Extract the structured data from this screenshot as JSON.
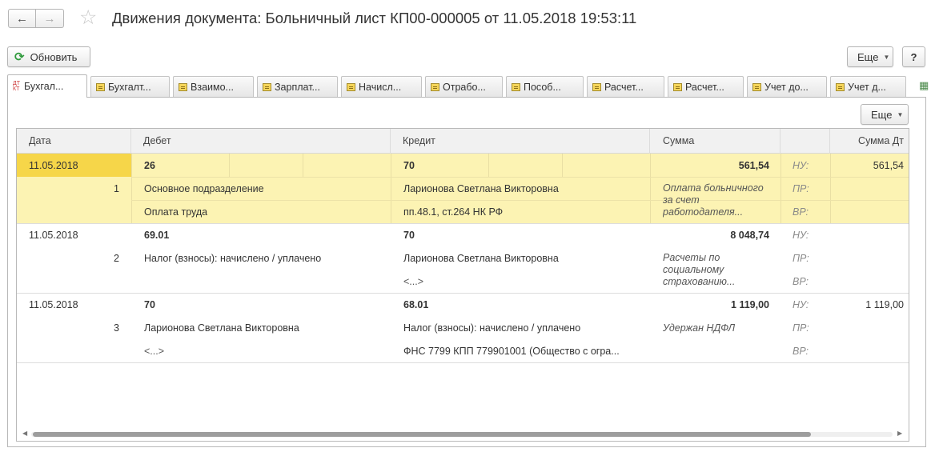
{
  "window": {
    "title": "Движения документа: Больничный лист КП00-000005 от 11.05.2018 19:53:11",
    "back_icon": "arrow-left-icon",
    "forward_icon": "arrow-right-icon",
    "favorite_icon": "star-icon"
  },
  "toolbar": {
    "refresh_label": "Обновить",
    "more_label": "Еще",
    "help_label": "?"
  },
  "tabs": [
    {
      "label": "Бухгал...",
      "icon": "dt-kt-icon",
      "active": true
    },
    {
      "label": "Бухгалт...",
      "icon": "register-icon"
    },
    {
      "label": "Взаимо...",
      "icon": "register-icon"
    },
    {
      "label": "Зарплат...",
      "icon": "register-icon"
    },
    {
      "label": "Начисл...",
      "icon": "register-icon"
    },
    {
      "label": "Отрабо...",
      "icon": "register-icon"
    },
    {
      "label": "Пособ...",
      "icon": "register-icon"
    },
    {
      "label": "Расчет...",
      "icon": "register-icon"
    },
    {
      "label": "Расчет...",
      "icon": "register-icon"
    },
    {
      "label": "Учет до...",
      "icon": "register-icon"
    },
    {
      "label": "Учет д...",
      "icon": "register-icon"
    }
  ],
  "panel": {
    "more_label": "Еще"
  },
  "table": {
    "columns": {
      "date": "Дата",
      "debit": "Дебет",
      "credit": "Кредит",
      "sum": "Сумма",
      "sum_dt": "Сумма Дт"
    },
    "rows": [
      {
        "date": "11.05.2018",
        "num": "1",
        "debit_account": "26",
        "debit_sub1": "Основное подразделение",
        "debit_sub2": "Оплата труда",
        "credit_account": "70",
        "credit_sub1": "Ларионова Светлана Викторовна",
        "credit_sub2": "пп.48.1, ст.264 НК РФ",
        "sum": "561,54",
        "content": "Оплата больничного за счет работодателя...",
        "nu": "НУ:",
        "pr": "ПР:",
        "vr": "ВР:",
        "sum_dt": "561,54"
      },
      {
        "date": "11.05.2018",
        "num": "2",
        "debit_account": "69.01",
        "debit_sub1": "Налог (взносы): начислено / уплачено",
        "debit_sub2": "",
        "credit_account": "70",
        "credit_sub1": "Ларионова Светлана Викторовна",
        "credit_sub2": "<...>",
        "sum": "8 048,74",
        "content": "Расчеты по социальному страхованию...",
        "nu": "НУ:",
        "pr": "ПР:",
        "vr": "ВР:",
        "sum_dt": ""
      },
      {
        "date": "11.05.2018",
        "num": "3",
        "debit_account": "70",
        "debit_sub1": "Ларионова Светлана Викторовна",
        "debit_sub2": "<...>",
        "credit_account": "68.01",
        "credit_sub1": "Налог (взносы): начислено / уплачено",
        "credit_sub2": "ФНС 7799 КПП 779901001 (Общество с огра...",
        "sum": "1 119,00",
        "content": "Удержан НДФЛ",
        "nu": "НУ:",
        "pr": "ПР:",
        "vr": "ВР:",
        "sum_dt": "1 119,00"
      }
    ]
  },
  "colors": {
    "selected_row": "#fcf3b3",
    "selected_cell": "#f6d649",
    "refresh_icon": "#2e9a3b"
  }
}
